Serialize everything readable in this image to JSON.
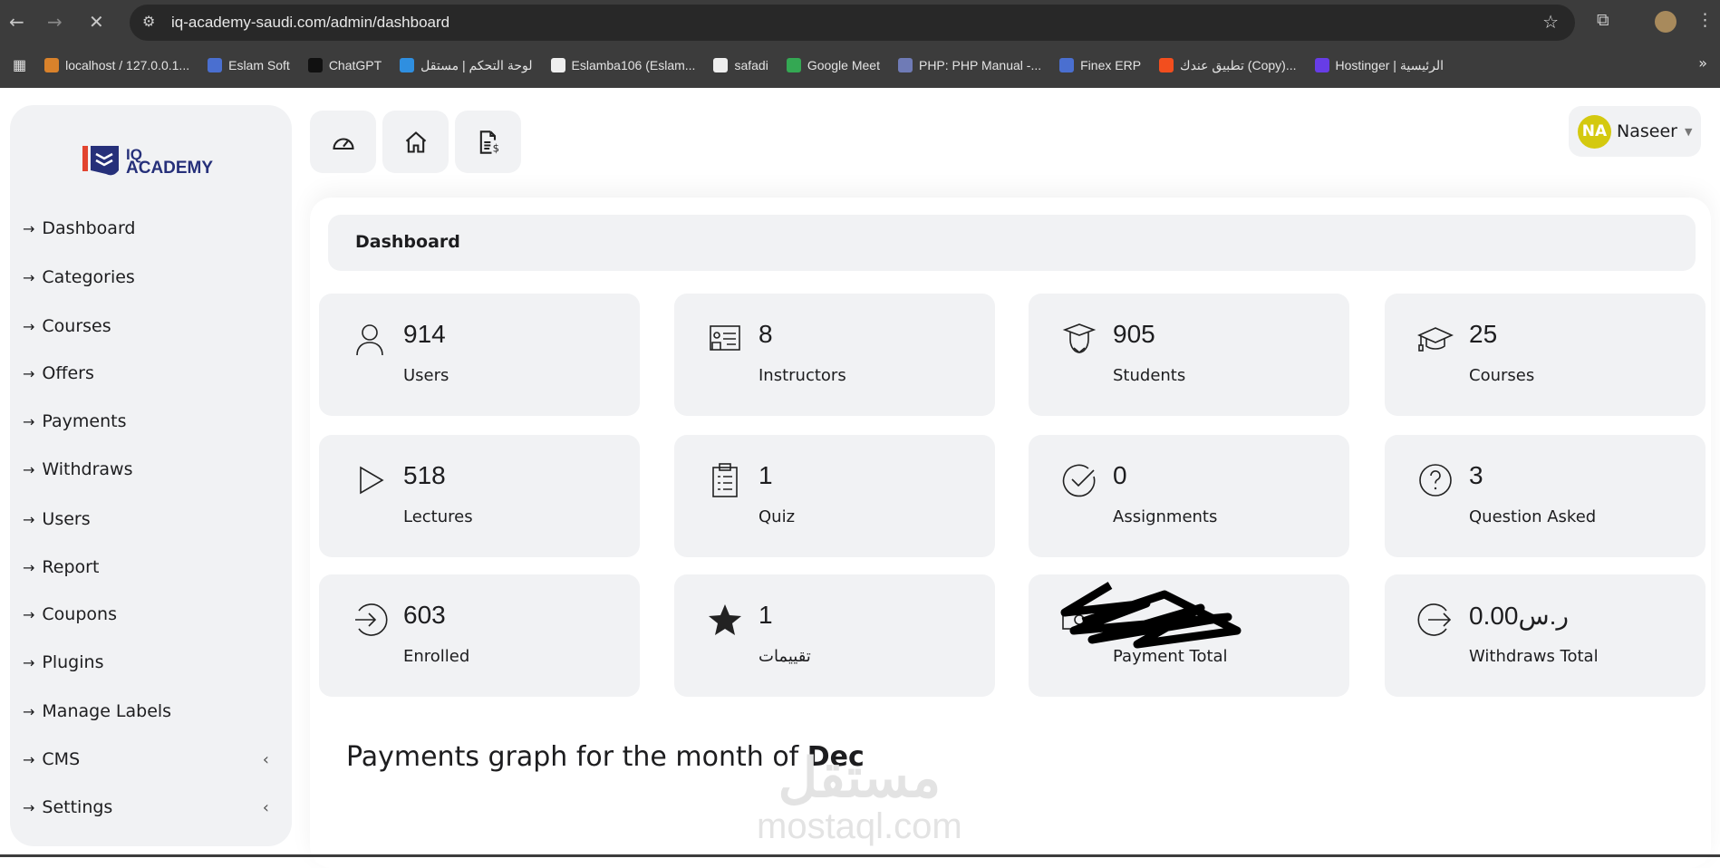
{
  "browser": {
    "url": "iq-academy-saudi.com/admin/dashboard",
    "bookmarks": [
      {
        "label": "localhost / 127.0.0.1...",
        "color": "#d9822b"
      },
      {
        "label": "Eslam Soft",
        "color": "#4a6fd0"
      },
      {
        "label": "ChatGPT",
        "color": "#111111"
      },
      {
        "label": "لوحة التحكم | مستقل",
        "color": "#2f8fe0"
      },
      {
        "label": "Eslamba106 (Eslam...",
        "color": "#eeeeee"
      },
      {
        "label": "safadi",
        "color": "#eeeeee"
      },
      {
        "label": "Google Meet",
        "color": "#34a853"
      },
      {
        "label": "PHP: PHP Manual -...",
        "color": "#6f7bb6"
      },
      {
        "label": "Finex ERP",
        "color": "#4a6fd0"
      },
      {
        "label": "تطبيق عندك (Copy)...",
        "color": "#f24e1e"
      },
      {
        "label": "Hostinger | الرئيسية",
        "color": "#673de6"
      }
    ]
  },
  "logo": {
    "text1": "IQ",
    "text2": "ACADEMY"
  },
  "sidebar": {
    "items": [
      {
        "label": "Dashboard"
      },
      {
        "label": "Categories"
      },
      {
        "label": "Courses"
      },
      {
        "label": "Offers"
      },
      {
        "label": "Payments"
      },
      {
        "label": "Withdraws"
      },
      {
        "label": "Users"
      },
      {
        "label": "Report"
      },
      {
        "label": "Coupons"
      },
      {
        "label": "Plugins"
      },
      {
        "label": "Manage Labels"
      },
      {
        "label": "CMS",
        "expandable": true
      },
      {
        "label": "Settings",
        "expandable": true
      }
    ]
  },
  "user": {
    "initials": "NA",
    "name": "Naseer",
    "avatar_color": "#d4c90f"
  },
  "header": {
    "title": "Dashboard"
  },
  "stats": [
    {
      "value": "914",
      "label": "Users",
      "icon": "user-icon"
    },
    {
      "value": "8",
      "label": "Instructors",
      "icon": "instructor-icon"
    },
    {
      "value": "905",
      "label": "Students",
      "icon": "student-icon"
    },
    {
      "value": "25",
      "label": "Courses",
      "icon": "graduation-cap-icon"
    },
    {
      "value": "518",
      "label": "Lectures",
      "icon": "play-icon"
    },
    {
      "value": "1",
      "label": "Quiz",
      "icon": "clipboard-icon"
    },
    {
      "value": "0",
      "label": "Assignments",
      "icon": "check-circle-icon"
    },
    {
      "value": "3",
      "label": "Question Asked",
      "icon": "question-circle-icon"
    },
    {
      "value": "603",
      "label": "Enrolled",
      "icon": "sign-in-icon"
    },
    {
      "value": "1",
      "label": "تقييمات",
      "icon": "star-icon"
    },
    {
      "value": "",
      "label": "Payment Total",
      "icon": "money-icon"
    },
    {
      "value": "0.00ر.س",
      "label": "Withdraws Total",
      "icon": "sign-out-icon"
    }
  ],
  "graph": {
    "title": "Payments graph for the month of",
    "month": "Dec"
  },
  "watermark": {
    "arabic": "مستقل",
    "latin": "mostaql.com"
  }
}
